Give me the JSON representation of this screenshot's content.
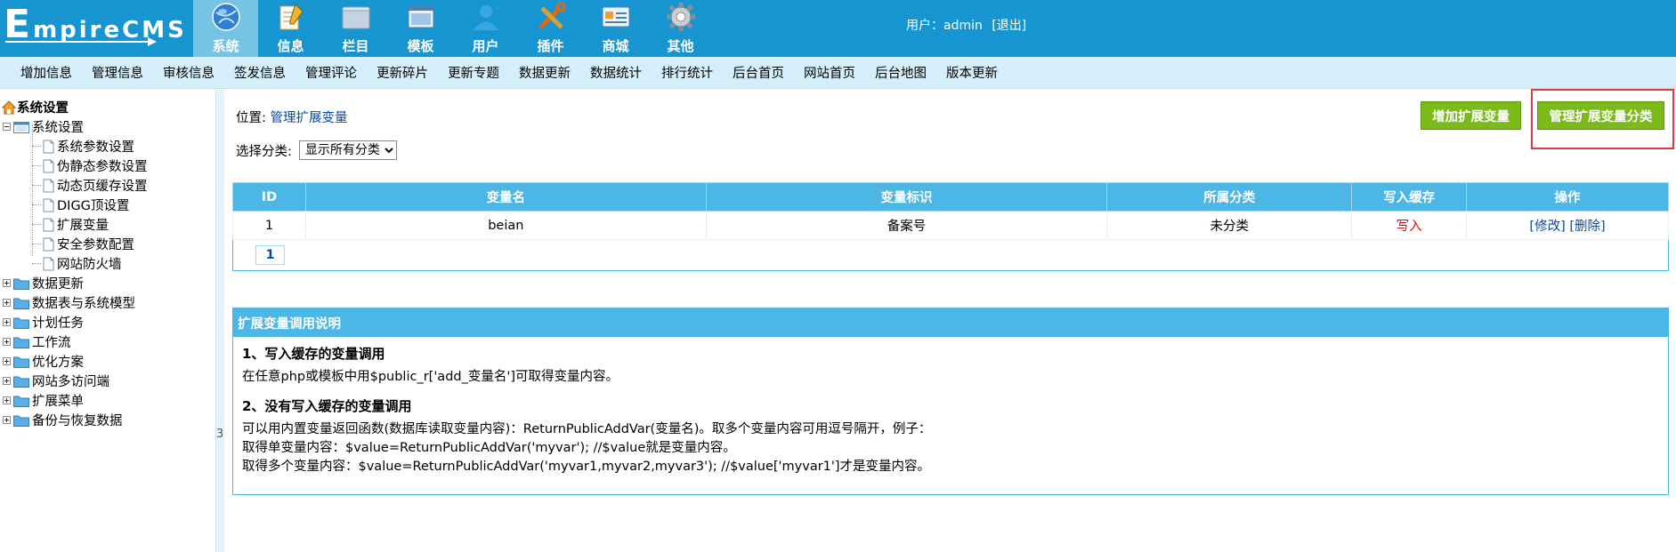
{
  "logo": {
    "first": "E",
    "rest": "mpireCMS"
  },
  "main_nav": [
    {
      "label": "系统",
      "icon": "globe-icon",
      "active": true
    },
    {
      "label": "信息",
      "icon": "notepad-icon",
      "active": false
    },
    {
      "label": "栏目",
      "icon": "folder-icon",
      "active": false
    },
    {
      "label": "模板",
      "icon": "window-icon",
      "active": false
    },
    {
      "label": "用户",
      "icon": "user-icon",
      "active": false
    },
    {
      "label": "插件",
      "icon": "tools-icon",
      "active": false
    },
    {
      "label": "商城",
      "icon": "card-icon",
      "active": false
    },
    {
      "label": "其他",
      "icon": "gear-icon",
      "active": false
    }
  ],
  "user": {
    "prefix": "用户：",
    "name": "admin",
    "logout": "[退出]"
  },
  "sub_nav": [
    "增加信息",
    "管理信息",
    "审核信息",
    "签发信息",
    "管理评论",
    "更新碎片",
    "更新专题",
    "数据更新",
    "数据统计",
    "排行统计",
    "后台首页",
    "网站首页",
    "后台地图",
    "版本更新"
  ],
  "tree": {
    "root": "系统设置",
    "open_folder": "系统设置",
    "children": [
      "系统参数设置",
      "伪静态参数设置",
      "动态页缓存设置",
      "DIGG顶设置",
      "扩展变量",
      "安全参数配置",
      "网站防火墙"
    ],
    "folders": [
      "数据更新",
      "数据表与系统模型",
      "计划任务",
      "工作流",
      "优化方案",
      "网站多访问端",
      "扩展菜单",
      "备份与恢复数据"
    ]
  },
  "splitter_mark": "3",
  "location": {
    "label": "位置: ",
    "link": "管理扩展变量"
  },
  "filter": {
    "label": "选择分类:",
    "selected": "显示所有分类"
  },
  "buttons": {
    "add": "增加扩展变量",
    "manage_class": "管理扩展变量分类"
  },
  "table": {
    "headers": [
      "ID",
      "变量名",
      "变量标识",
      "所属分类",
      "写入缓存",
      "操作"
    ],
    "rows": [
      {
        "id": "1",
        "name": "beian",
        "ident": "备案号",
        "category": "未分类",
        "cache": "写入",
        "edit": "[修改]",
        "delete": "[删除]"
      }
    ],
    "page": "1"
  },
  "help": {
    "title": "扩展变量调用说明",
    "h1": "1、写入缓存的变量调用",
    "p1": "在任意php或模板中用$public_r['add_变量名']可取得变量内容。",
    "h2": "2、没有写入缓存的变量调用",
    "p2": "可以用内置变量返回函数(数据库读取变量内容)：ReturnPublicAddVar(变量名)。取多个变量内容可用逗号隔开，例子：",
    "p3": "取得单变量内容：$value=ReturnPublicAddVar('myvar'); //$value就是变量内容。",
    "p4": "取得多个变量内容：$value=ReturnPublicAddVar('myvar1,myvar2,myvar3'); //$value['myvar1']才是变量内容。"
  },
  "colors": {
    "header": "#1795d0",
    "subnav": "#d4eefa",
    "table_head": "#4cb6e4",
    "button": "#7cba1c",
    "highlight": "#e23a3a"
  }
}
